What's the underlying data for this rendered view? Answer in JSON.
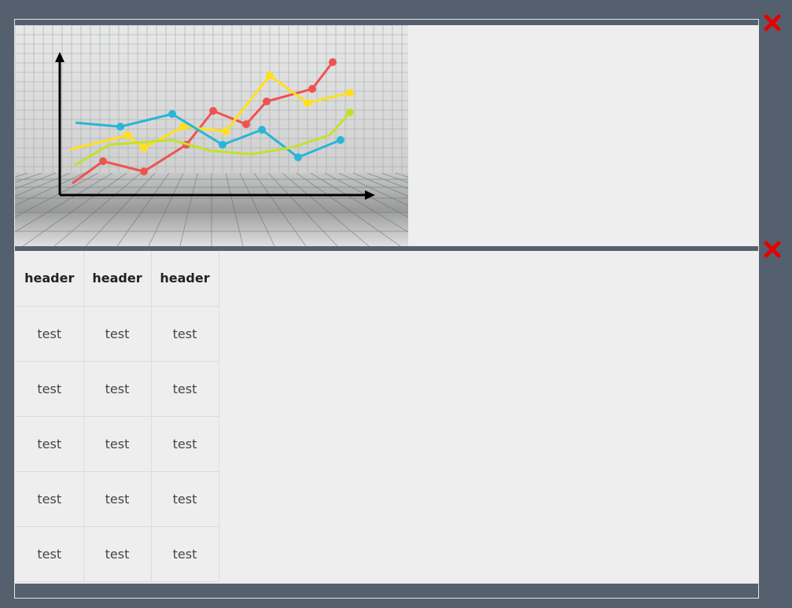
{
  "close_icon_color": "#e60000",
  "chart_image": {
    "icon": "line-chart-illustration",
    "background": "#d6d6d6",
    "axis_color": "#000000",
    "series_colors": [
      "#ef5350",
      "#ffe01a",
      "#29b6d6",
      "#c6e02a"
    ]
  },
  "table": {
    "headers": [
      "header",
      "header",
      "header"
    ],
    "rows": [
      [
        "test",
        "test",
        "test"
      ],
      [
        "test",
        "test",
        "test"
      ],
      [
        "test",
        "test",
        "test"
      ],
      [
        "test",
        "test",
        "test"
      ],
      [
        "test",
        "test",
        "test"
      ]
    ]
  }
}
